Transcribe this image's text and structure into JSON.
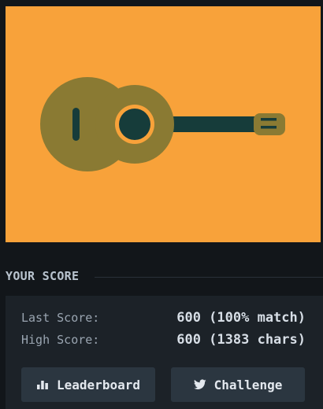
{
  "canvas": {
    "background": "#f8a23a",
    "colors": {
      "body": "#8a7a33",
      "soundhole": "#163c3a",
      "neck": "#163c3a",
      "headstock": "#8a7a33"
    },
    "subject": "guitar"
  },
  "score": {
    "heading": "YOUR SCORE",
    "last_label": "Last Score:",
    "last_value": "600 (100% match)",
    "high_label": "High Score:",
    "high_value": "600 (1383 chars)"
  },
  "buttons": {
    "leaderboard_label": "Leaderboard",
    "leaderboard_icon": "bar-chart-icon",
    "challenge_label": "Challenge",
    "challenge_icon": "twitter-icon"
  }
}
